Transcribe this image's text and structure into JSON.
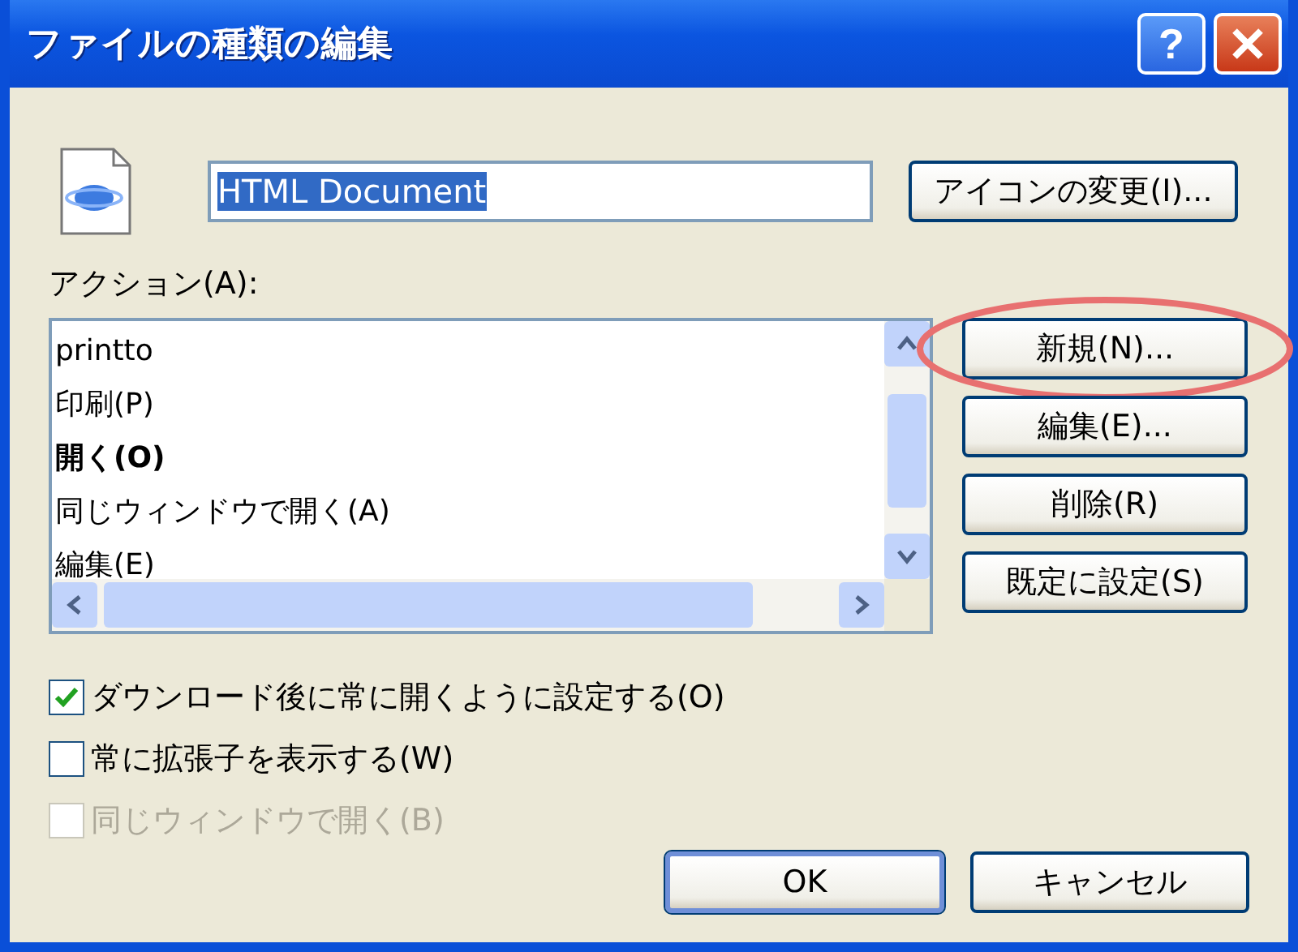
{
  "window": {
    "title": "ファイルの種類の編集",
    "help_button": "?"
  },
  "type_name": {
    "value": "HTML Document",
    "text_selected": true
  },
  "change_icon_button": "アイコンの変更(I)...",
  "actions": {
    "label": "アクション(A):",
    "items": [
      {
        "label": "printto",
        "default": false
      },
      {
        "label": "印刷(P)",
        "default": false
      },
      {
        "label": "開く(O)",
        "default": true
      },
      {
        "label": "同じウィンドウで開く(A)",
        "default": false
      },
      {
        "label": "編集(E)",
        "default": false
      }
    ]
  },
  "action_buttons": [
    {
      "label": "新規(N)...",
      "highlighted": true
    },
    {
      "label": "編集(E)...",
      "highlighted": false
    },
    {
      "label": "削除(R)",
      "highlighted": false
    },
    {
      "label": "既定に設定(S)",
      "highlighted": false
    }
  ],
  "options": [
    {
      "label": "ダウンロード後に常に開くように設定する(O)",
      "checked": true,
      "disabled": false
    },
    {
      "label": "常に拡張子を表示する(W)",
      "checked": false,
      "disabled": false
    },
    {
      "label": "同じウィンドウで開く(B)",
      "checked": false,
      "disabled": true
    }
  ],
  "buttons": [
    {
      "label": "OK",
      "default": true
    },
    {
      "label": "キャンセル",
      "default": false
    }
  ]
}
